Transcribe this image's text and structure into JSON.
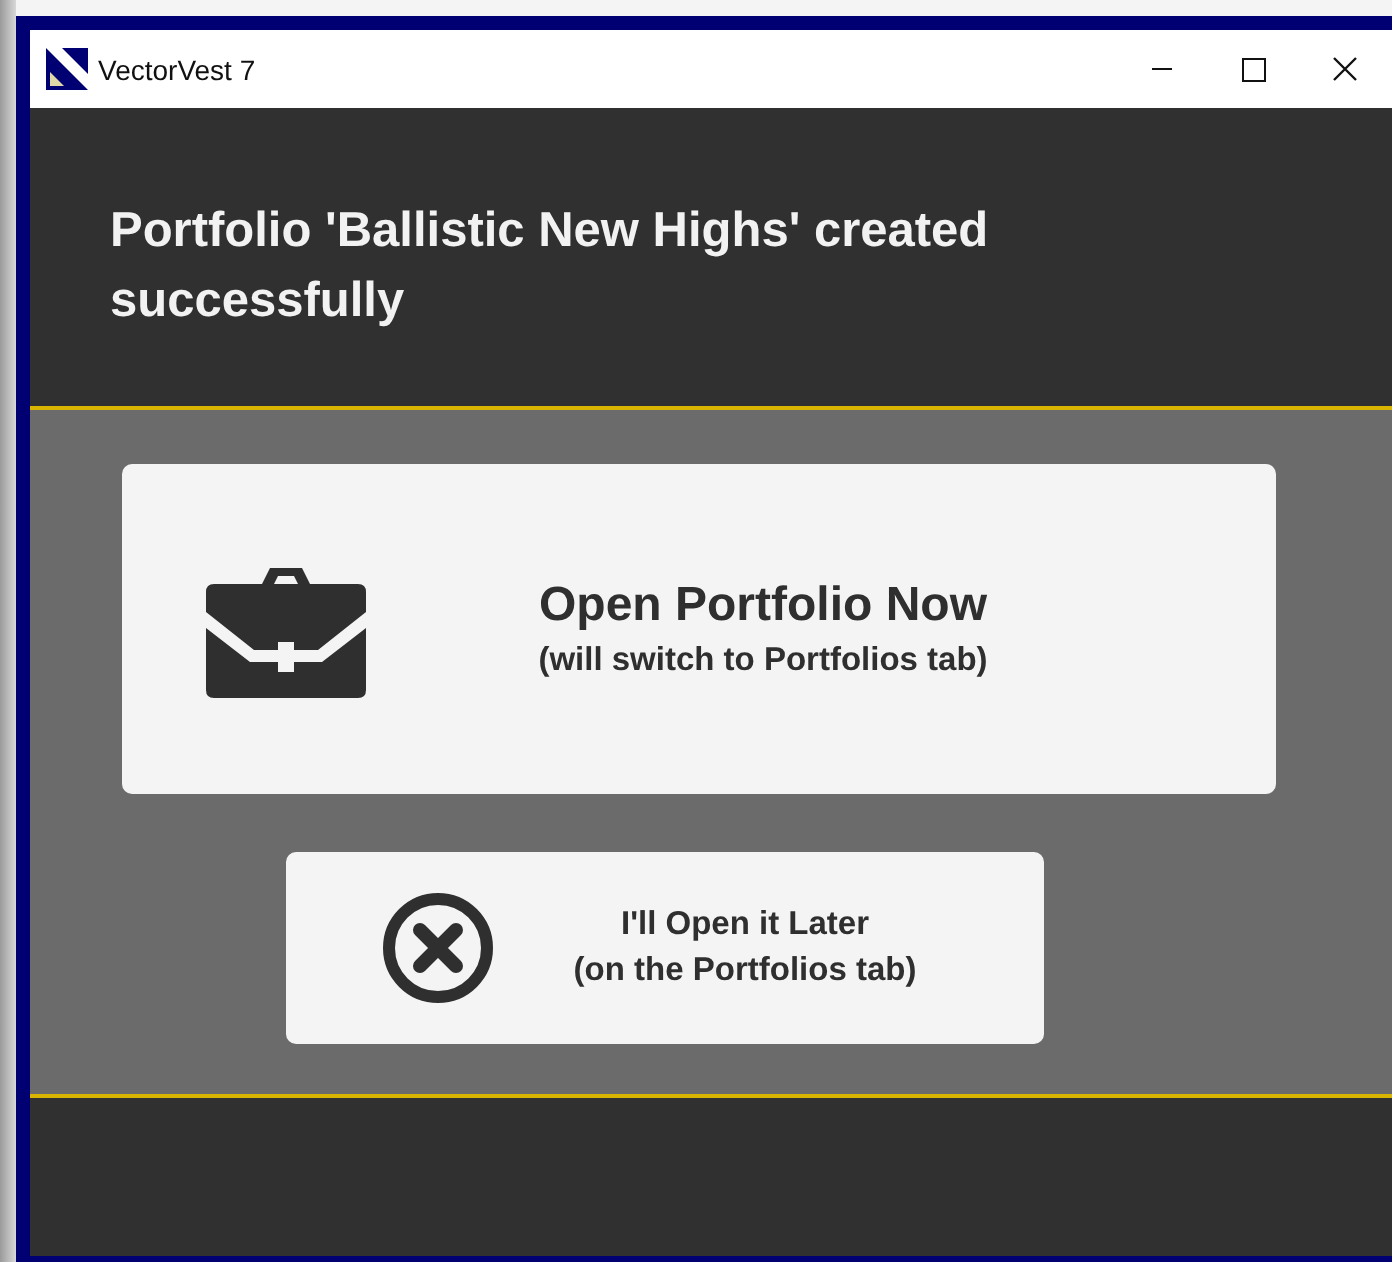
{
  "window": {
    "title": "VectorVest 7"
  },
  "header": {
    "message": "Portfolio 'Ballistic New Highs' created successfully"
  },
  "actions": [
    {
      "kind": "primary",
      "title": "Open Portfolio Now",
      "subtitle": "(will switch to Portfolios tab)"
    },
    {
      "kind": "secondary",
      "title": "I'll Open it Later",
      "subtitle": "(on the Portfolios tab)"
    }
  ]
}
